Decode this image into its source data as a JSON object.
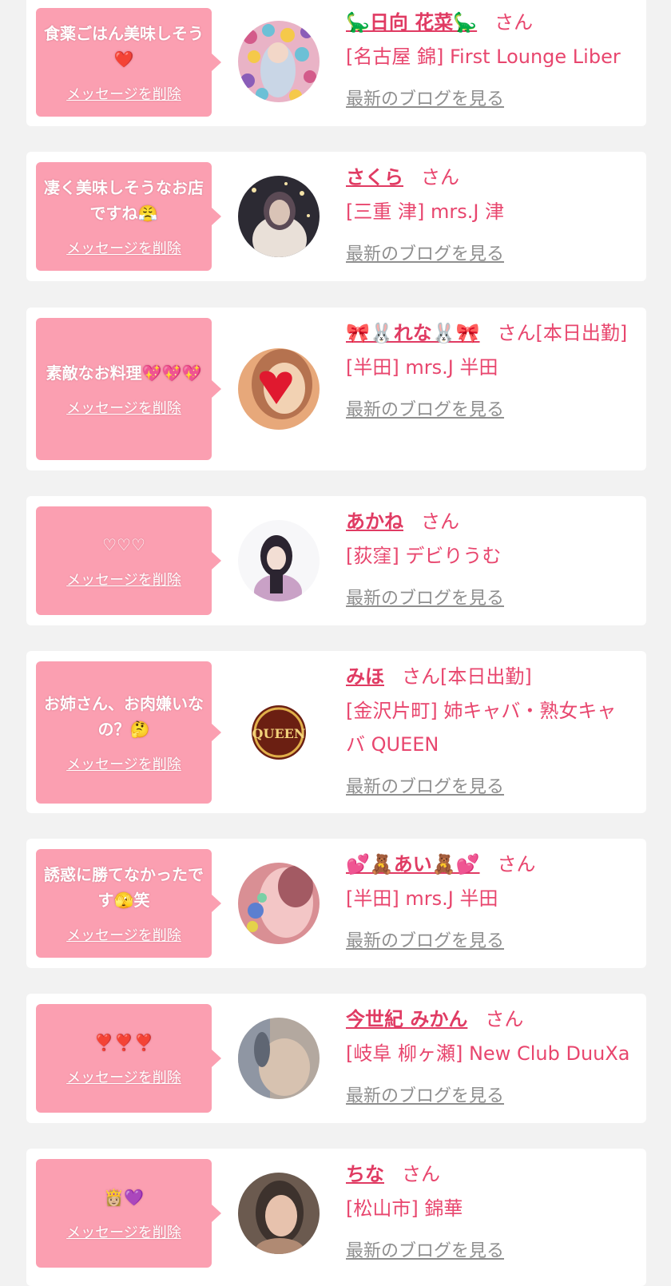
{
  "cards": [
    {
      "message": "食薬ごはん美味しそう❤️",
      "delete_label": "メッセージを削除",
      "name": "🦕日向 花菜🦕",
      "honorific": "さん",
      "shop": "[名古屋 錦] First Lounge Liber",
      "blog_label": "最新のブログを見る",
      "avatar_colors": [
        "#d35b8a",
        "#6cc0d6",
        "#f5c94a",
        "#8a5db8"
      ]
    },
    {
      "message": "凄く美味しそうなお店ですね😤",
      "delete_label": "メッセージを削除",
      "name": "さくら",
      "honorific": "さん",
      "shop": "[三重 津] mrs.J 津",
      "blog_label": "最新のブログを見る",
      "avatar_colors": [
        "#2c2a33",
        "#b98e6e",
        "#e9e0d8",
        "#5b4a55"
      ]
    },
    {
      "message": "素敵なお料理💖💖💖",
      "delete_label": "メッセージを削除",
      "name": "🎀🐰れな🐰🎀",
      "honorific": "さん[本日出勤]",
      "shop": "[半田] mrs.J 半田",
      "blog_label": "最新のブログを見る",
      "avatar_colors": [
        "#e7a87a",
        "#f2d2b3",
        "#e0192f",
        "#7a4b3a"
      ]
    },
    {
      "message": "♡♡♡",
      "delete_label": "メッセージを削除",
      "name": "あかね",
      "honorific": "さん",
      "shop": "[荻窪] デビりうむ",
      "blog_label": "最新のブログを見る",
      "avatar_colors": [
        "#f7f7f9",
        "#2b2430",
        "#c9a1c6",
        "#e9d6e6"
      ]
    },
    {
      "message": "お姉さん、お肉嫌いなの？🤔",
      "delete_label": "メッセージを削除",
      "name": "みほ",
      "honorific": "さん[本日出勤]",
      "shop": "[金沢片町] 姉キャバ・熟女キャバ QUEEN",
      "blog_label": "最新のブログを見る",
      "avatar_logo": "QUEEN"
    },
    {
      "message": "誘惑に勝てなかったです🫣笑",
      "delete_label": "メッセージを削除",
      "name": "💕🧸あい🧸💕",
      "honorific": "さん",
      "shop": "[半田] mrs.J 半田",
      "blog_label": "最新のブログを見る",
      "avatar_colors": [
        "#d98f94",
        "#f3c6c6",
        "#5c7fd0",
        "#a35a63"
      ]
    },
    {
      "message": "❣️❣️❣️",
      "delete_label": "メッセージを削除",
      "name": "今世紀 みかん",
      "honorific": "さん",
      "shop": "[岐阜 柳ヶ瀬] New Club DuuXa",
      "blog_label": "最新のブログを見る",
      "avatar_colors": [
        "#8f96a3",
        "#d7c2b0",
        "#b3a89f",
        "#5f6673"
      ]
    },
    {
      "message": "👸🏼💜",
      "delete_label": "メッセージを削除",
      "name": "ちな",
      "honorific": "さん",
      "shop": "[松山市] 錦華",
      "blog_label": "最新のブログを見る",
      "avatar_colors": [
        "#6b5a4f",
        "#e7c2ad",
        "#3d322d",
        "#b08a73"
      ]
    }
  ]
}
